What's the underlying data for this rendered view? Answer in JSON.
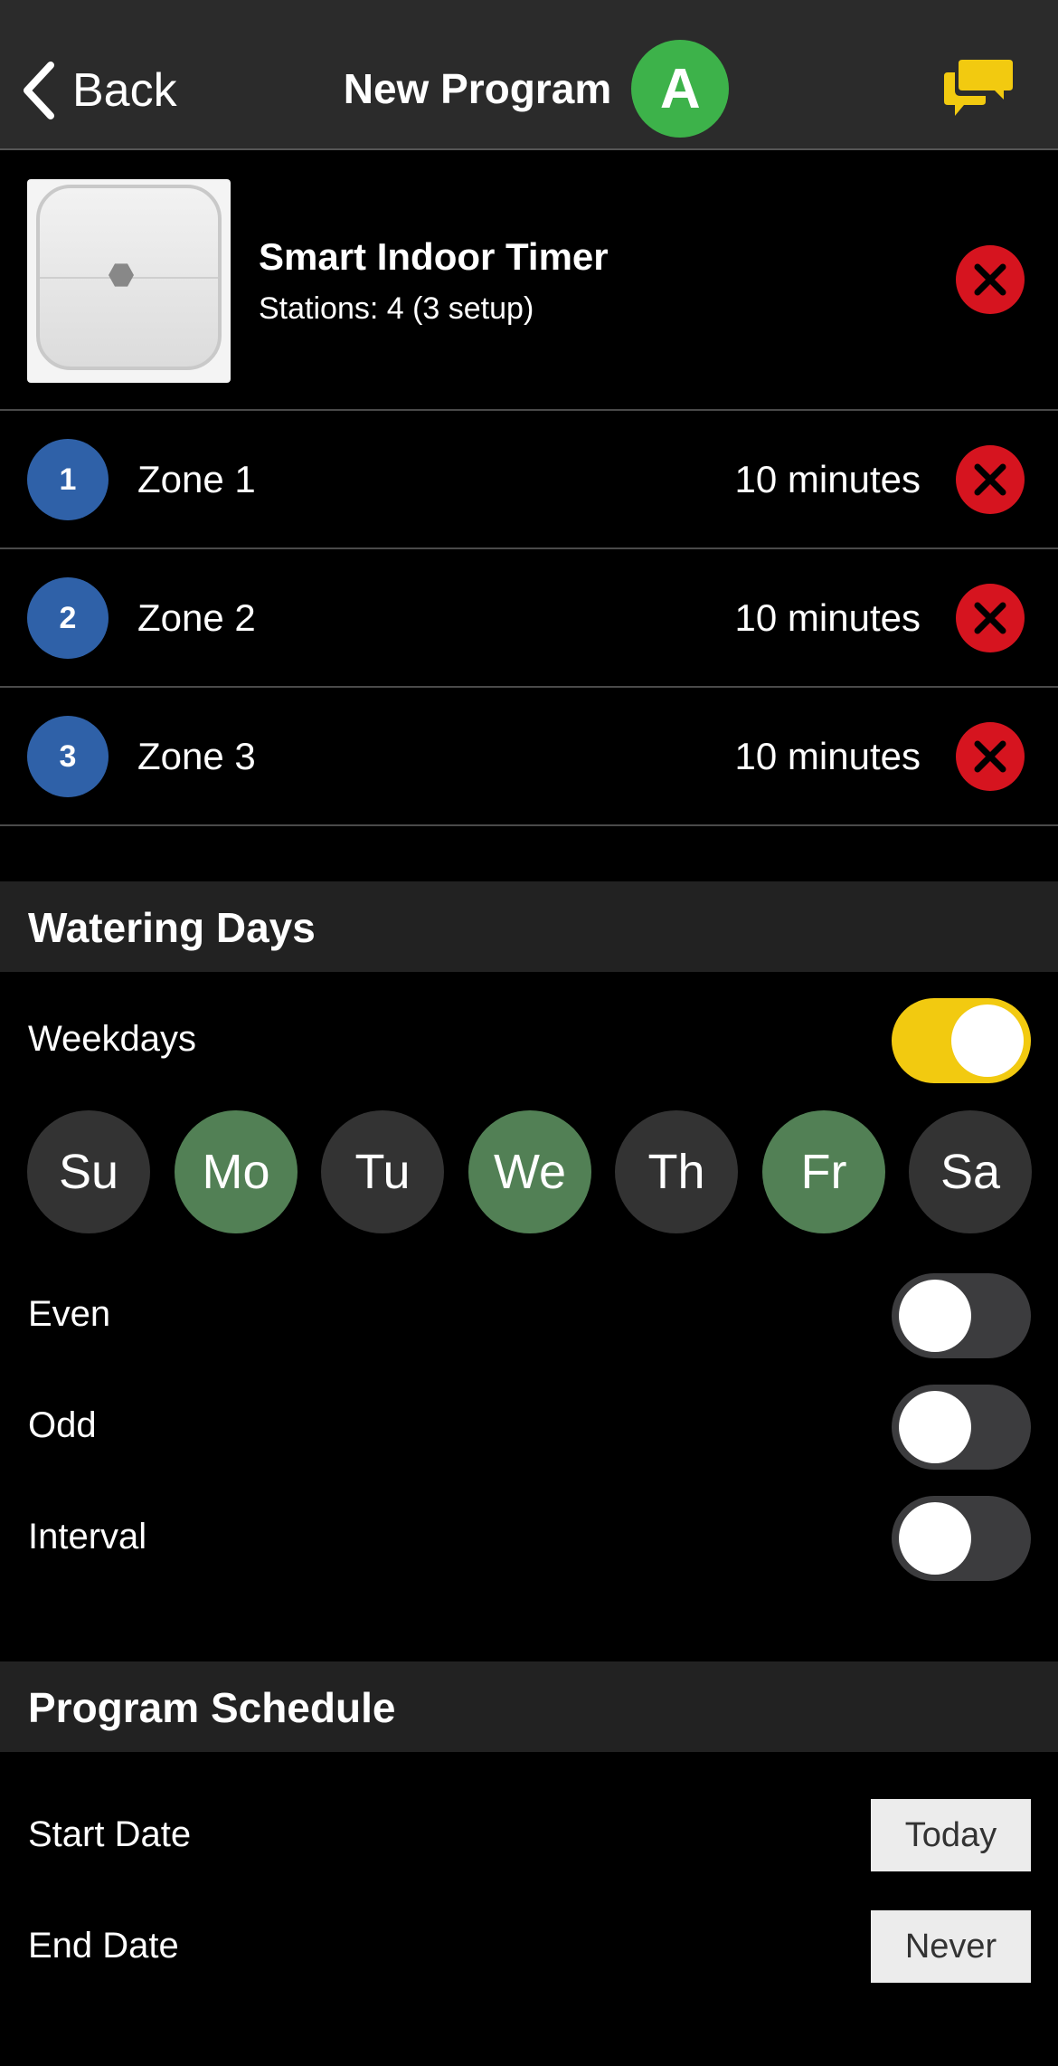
{
  "header": {
    "back_label": "Back",
    "title": "New Program",
    "program_badge": "A",
    "icons": {
      "back": "chevron-left-icon",
      "messages": "chat-bubbles-icon"
    },
    "colors": {
      "badge": "#3db24a",
      "messages_icon": "#f2ca10"
    }
  },
  "device": {
    "name": "Smart Indoor Timer",
    "stations": "Stations: 4 (3 setup)"
  },
  "zones": [
    {
      "number": "1",
      "name": "Zone 1",
      "duration": "10 minutes"
    },
    {
      "number": "2",
      "name": "Zone 2",
      "duration": "10 minutes"
    },
    {
      "number": "3",
      "name": "Zone 3",
      "duration": "10 minutes"
    }
  ],
  "watering_days": {
    "title": "Watering Days",
    "weekdays": {
      "label": "Weekdays",
      "on": true
    },
    "days": [
      {
        "label": "Su",
        "selected": false
      },
      {
        "label": "Mo",
        "selected": true
      },
      {
        "label": "Tu",
        "selected": false
      },
      {
        "label": "We",
        "selected": true
      },
      {
        "label": "Th",
        "selected": false
      },
      {
        "label": "Fr",
        "selected": true
      },
      {
        "label": "Sa",
        "selected": false
      }
    ],
    "even": {
      "label": "Even",
      "on": false
    },
    "odd": {
      "label": "Odd",
      "on": false
    },
    "interval": {
      "label": "Interval",
      "on": false
    }
  },
  "schedule": {
    "title": "Program Schedule",
    "start_date": {
      "label": "Start Date",
      "value": "Today"
    },
    "end_date": {
      "label": "End Date",
      "value": "Never"
    }
  },
  "colors": {
    "toggle_on": "#f2ca10",
    "day_selected": "#528055",
    "remove": "#d6141f",
    "zone_badge": "#2f61a8"
  }
}
